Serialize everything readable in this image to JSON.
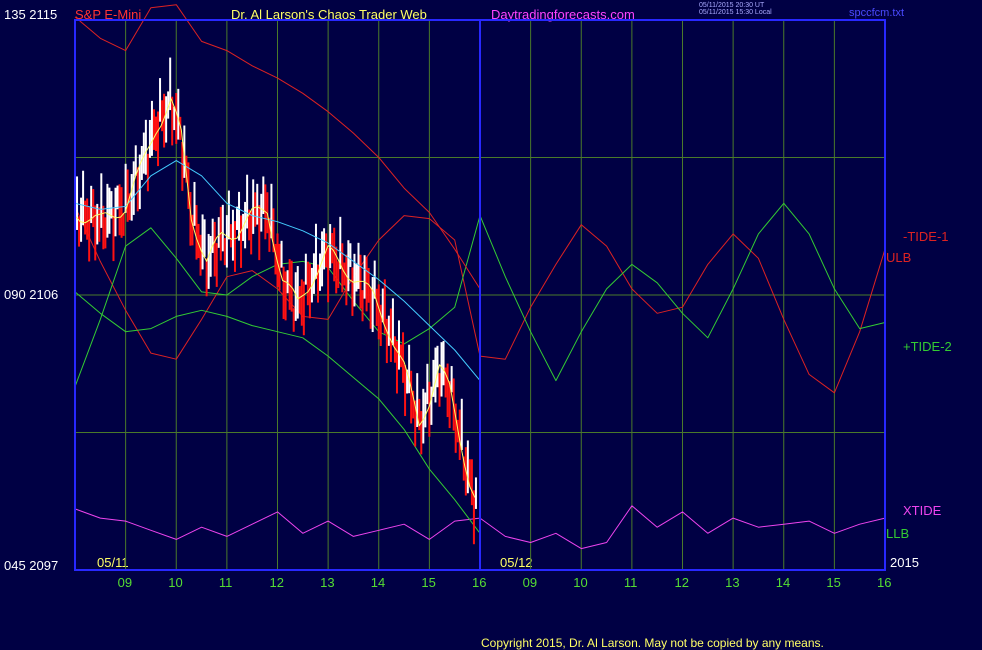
{
  "header": {
    "symbol": "S&P E-Mini",
    "title": "Dr. Al Larson's Chaos Trader Web",
    "site": "Daytradingforecasts.com",
    "timestamp_1": "05/11/2015 20:30 UT",
    "timestamp_2": "05/11/2015 15:30 Local",
    "filename": "spccfcm.txt"
  },
  "y_axis": {
    "top_label": "135 2115",
    "mid_label": "090 2106",
    "bottom_label": "045 2097"
  },
  "dates": {
    "day1": "05/11",
    "day2": "05/12",
    "year": "2015"
  },
  "x_ticks": [
    "09",
    "10",
    "11",
    "12",
    "13",
    "14",
    "15",
    "16",
    "09",
    "10",
    "11",
    "12",
    "13",
    "14",
    "15",
    "16"
  ],
  "line_labels": {
    "tide1": "-TIDE-1",
    "ulb": "ULB",
    "tide2": "+TIDE-2",
    "xtide": "XTIDE",
    "llb": "LLB"
  },
  "copyright": "Copyright 2015, Dr. Al Larson. May not be copied by any means.",
  "colors": {
    "background": "#000044",
    "frame": "#2828ff",
    "grid": "#4a7a2a",
    "price_up": "#ffffff",
    "price_down": "#ff1111",
    "moving_avg": "#ffff66",
    "slow_avg": "#44ccff",
    "tide1": "#dd2222",
    "tide2": "#33cc33",
    "xtide": "#ee44ee",
    "header_symbol": "#ff3333",
    "header_title": "#ffff66",
    "header_site": "#ff44ff",
    "axis_text": "#ffffff",
    "x_tick_text": "#55dd33"
  },
  "chart_data": {
    "type": "line",
    "title": "S&P E-Mini",
    "xlabel": "",
    "ylabel": "",
    "ylim": [
      2097,
      2115
    ],
    "x_range_hours": [
      8.0,
      16.0
    ],
    "x_axis_note": "two sessions 05/11 and 05/12, hours 09-16 each",
    "series": [
      {
        "name": "",
        "kind": "price",
        "day": "05/11",
        "x": [
          8.0,
          8.5,
          9.0,
          9.3,
          9.6,
          9.9,
          10.1,
          10.3,
          10.6,
          10.9,
          11.2,
          11.5,
          11.8,
          12.1,
          12.4,
          12.7,
          13.0,
          13.3,
          13.6,
          13.9,
          14.2,
          14.5,
          14.8,
          15.0,
          15.2,
          15.4,
          15.6,
          15.8,
          15.95
        ],
        "y": [
          2108.7,
          2108.4,
          2108.9,
          2110.1,
          2111.5,
          2112.3,
          2111.2,
          2108.6,
          2107.1,
          2107.9,
          2108.1,
          2108.6,
          2108.8,
          2106.5,
          2105.7,
          2106.6,
          2107.4,
          2106.9,
          2106.5,
          2105.9,
          2104.9,
          2103.6,
          2101.8,
          2102.6,
          2103.6,
          2102.9,
          2101.4,
          2099.9,
          2099.1
        ]
      },
      {
        "name": "",
        "kind": "slow average",
        "day": "05/11",
        "x": [
          8.0,
          8.5,
          9.0,
          9.5,
          10.0,
          10.5,
          11.0,
          11.5,
          12.0,
          12.5,
          13.0,
          13.5,
          14.0,
          14.5,
          15.0,
          15.5,
          16.0
        ],
        "y": [
          2109.0,
          2108.8,
          2108.9,
          2109.9,
          2110.4,
          2109.9,
          2109.0,
          2108.6,
          2108.4,
          2108.1,
          2107.7,
          2107.1,
          2106.5,
          2105.8,
          2105.0,
          2104.2,
          2103.2
        ]
      },
      {
        "name": "-TIDE-1",
        "kind": "tide",
        "x": [
          8.0,
          8.5,
          9.0,
          9.5,
          10.0,
          10.5,
          11.0,
          11.5,
          12.0,
          12.5,
          13.0,
          13.5,
          14.0,
          14.5,
          15.0,
          15.5,
          16.0,
          16.5,
          17.0,
          17.5,
          18.0,
          18.5,
          19.0,
          19.5,
          20.0,
          20.5,
          21.0,
          21.5,
          22.0,
          22.5,
          23.0,
          23.5,
          24.0
        ],
        "y": [
          2108.9,
          2107.1,
          2105.5,
          2104.1,
          2103.9,
          2105.2,
          2106.6,
          2106.8,
          2106.2,
          2105.3,
          2105.2,
          2106.6,
          2107.8,
          2108.6,
          2108.5,
          2107.8,
          2104.0,
          2103.9,
          2105.6,
          2107.0,
          2108.3,
          2107.6,
          2106.2,
          2105.4,
          2105.6,
          2107.0,
          2108.0,
          2107.2,
          2105.2,
          2103.4,
          2102.8,
          2104.8,
          2107.5
        ]
      },
      {
        "name": "+TIDE-2",
        "kind": "tide",
        "x": [
          8.0,
          8.5,
          9.0,
          9.5,
          10.0,
          10.5,
          11.0,
          11.5,
          12.0,
          12.5,
          13.0,
          13.5,
          14.0,
          14.5,
          15.0,
          15.5,
          16.0,
          16.5,
          17.0,
          17.5,
          18.0,
          18.5,
          19.0,
          19.5,
          20.0,
          20.5,
          21.0,
          21.5,
          22.0,
          22.5,
          23.0,
          23.5,
          24.0
        ],
        "y": [
          2103.0,
          2105.2,
          2107.6,
          2108.2,
          2107.2,
          2106.1,
          2106.0,
          2106.6,
          2107.0,
          2107.1,
          2106.9,
          2105.8,
          2104.8,
          2104.4,
          2104.9,
          2105.6,
          2108.6,
          2106.6,
          2104.8,
          2103.2,
          2104.8,
          2106.2,
          2107.0,
          2106.4,
          2105.4,
          2104.6,
          2106.2,
          2108.0,
          2109.0,
          2108.0,
          2106.2,
          2104.9,
          2105.1
        ]
      },
      {
        "name": "XTIDE",
        "kind": "oscillator",
        "x": [
          8.0,
          8.5,
          9.0,
          9.5,
          10.0,
          10.5,
          11.0,
          11.5,
          12.0,
          12.5,
          13.0,
          13.5,
          14.0,
          14.5,
          15.0,
          15.5,
          16.0,
          16.5,
          17.0,
          17.5,
          18.0,
          18.5,
          19.0,
          19.5,
          20.0,
          20.5,
          21.0,
          21.5,
          22.0,
          22.5,
          23.0,
          23.5,
          24.0
        ],
        "y": [
          2099.0,
          2098.7,
          2098.6,
          2098.3,
          2098.0,
          2098.4,
          2098.1,
          2098.5,
          2098.9,
          2098.2,
          2098.6,
          2098.1,
          2098.3,
          2098.5,
          2098.0,
          2098.6,
          2098.7,
          2098.1,
          2097.9,
          2098.2,
          2097.7,
          2097.9,
          2099.1,
          2098.4,
          2098.9,
          2098.2,
          2098.7,
          2098.4,
          2098.5,
          2098.6,
          2098.2,
          2098.5,
          2098.7
        ]
      },
      {
        "name": "ULB",
        "kind": "upper band",
        "x": [
          8.0,
          8.5,
          9.0,
          9.5,
          10.0,
          10.5,
          11.0,
          11.5,
          12.0,
          12.5,
          13.0,
          13.5,
          14.0,
          14.5,
          15.0,
          15.5,
          16.0
        ],
        "y": [
          2115.1,
          2114.4,
          2114.0,
          2115.4,
          2115.5,
          2114.3,
          2114.0,
          2113.5,
          2113.1,
          2112.6,
          2112.0,
          2111.3,
          2110.5,
          2109.5,
          2108.7,
          2107.5,
          2106.2
        ]
      },
      {
        "name": "LLB",
        "kind": "lower band",
        "x": [
          8.0,
          8.5,
          9.0,
          9.5,
          10.0,
          10.5,
          11.0,
          11.5,
          12.0,
          12.5,
          13.0,
          13.5,
          14.0,
          14.5,
          15.0,
          15.5,
          16.0
        ],
        "y": [
          2106.1,
          2105.4,
          2104.8,
          2104.9,
          2105.3,
          2105.5,
          2105.3,
          2105.0,
          2104.8,
          2104.6,
          2104.0,
          2103.3,
          2102.6,
          2101.6,
          2100.3,
          2099.3,
          2098.2
        ]
      }
    ],
    "grid": true,
    "legend": "right side labels"
  }
}
